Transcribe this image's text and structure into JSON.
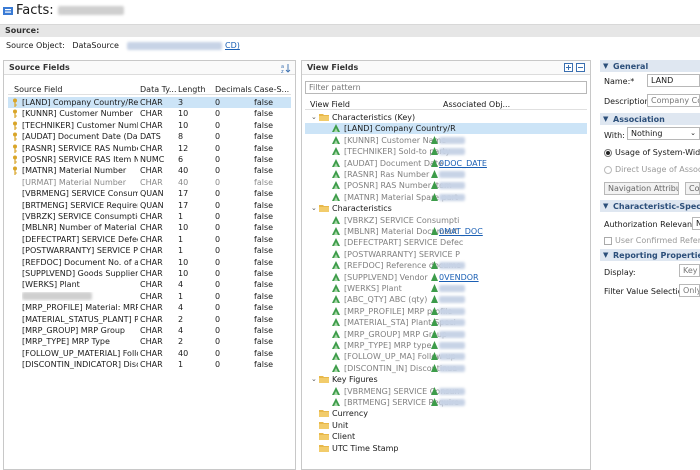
{
  "window": {
    "title": "Facts:"
  },
  "source_section": {
    "label": "Source:",
    "object_label": "Source Object:",
    "object_type": "DataSource",
    "object_link": "CD)"
  },
  "source_fields": {
    "title": "Source Fields",
    "columns": [
      "Source Field",
      "Data Ty...",
      "Length",
      "Decimals",
      "Case-S..."
    ],
    "rows": [
      {
        "field": "[LAND] Company Country/Regio",
        "type": "CHAR",
        "length": "3",
        "decimals": "0",
        "case": "false",
        "key": true,
        "selected": true
      },
      {
        "field": "[KUNNR] Customer Number",
        "type": "CHAR",
        "length": "10",
        "decimals": "0",
        "case": "false",
        "key": true
      },
      {
        "field": "[TECHNIKER] Customer Number",
        "type": "CHAR",
        "length": "10",
        "decimals": "0",
        "case": "false",
        "key": true
      },
      {
        "field": "[AUDAT] Document Date (Date R",
        "type": "DATS",
        "length": "8",
        "decimals": "0",
        "case": "false",
        "key": true
      },
      {
        "field": "[RASNR] SERVICE RAS Number",
        "type": "CHAR",
        "length": "12",
        "decimals": "0",
        "case": "false",
        "key": true
      },
      {
        "field": "[POSNR] SERVICE RAS Item Num",
        "type": "NUMC",
        "length": "6",
        "decimals": "0",
        "case": "false",
        "key": true
      },
      {
        "field": "[MATNR] Material Number",
        "type": "CHAR",
        "length": "40",
        "decimals": "0",
        "case": "false",
        "key": true
      },
      {
        "field": "[URMAT] Material Number",
        "type": "CHAR",
        "length": "40",
        "decimals": "0",
        "case": "false",
        "grey": true
      },
      {
        "field": "[VBRMENG] SERVICE Consumptic",
        "type": "QUAN",
        "length": "17",
        "decimals": "0",
        "case": "false"
      },
      {
        "field": "[BRTMENG] SERVICE Requiremen",
        "type": "QUAN",
        "length": "17",
        "decimals": "0",
        "case": "false"
      },
      {
        "field": "[VBRZK] SERVICE Consumption S",
        "type": "CHAR",
        "length": "1",
        "decimals": "0",
        "case": "false"
      },
      {
        "field": "[MBLNR] Number of Material Do",
        "type": "CHAR",
        "length": "10",
        "decimals": "0",
        "case": "false"
      },
      {
        "field": "[DEFECTPART] SERVICE Defect Pa",
        "type": "CHAR",
        "length": "1",
        "decimals": "0",
        "case": "false"
      },
      {
        "field": "[POSTWARRANTY] SERVICE Post",
        "type": "CHAR",
        "length": "1",
        "decimals": "0",
        "case": "false"
      },
      {
        "field": "[REFDOC] Document No. of a Ref",
        "type": "CHAR",
        "length": "10",
        "decimals": "0",
        "case": "false"
      },
      {
        "field": "[SUPPLVEND] Goods Supplier",
        "type": "CHAR",
        "length": "10",
        "decimals": "0",
        "case": "false"
      },
      {
        "field": "[WERKS] Plant",
        "type": "CHAR",
        "length": "4",
        "decimals": "0",
        "case": "false"
      },
      {
        "field": "",
        "type": "CHAR",
        "length": "1",
        "decimals": "0",
        "case": "false",
        "blurred": true
      },
      {
        "field": "[MRP_PROFILE] Material: MRP pr",
        "type": "CHAR",
        "length": "4",
        "decimals": "0",
        "case": "false"
      },
      {
        "field": "[MATERIAL_STATUS_PLANT] Plar",
        "type": "CHAR",
        "length": "2",
        "decimals": "0",
        "case": "false"
      },
      {
        "field": "[MRP_GROUP] MRP Group",
        "type": "CHAR",
        "length": "4",
        "decimals": "0",
        "case": "false"
      },
      {
        "field": "[MRP_TYPE] MRP Type",
        "type": "CHAR",
        "length": "2",
        "decimals": "0",
        "case": "false"
      },
      {
        "field": "[FOLLOW_UP_MATERIAL] Follow",
        "type": "CHAR",
        "length": "40",
        "decimals": "0",
        "case": "false"
      },
      {
        "field": "[DISCONTIN_INDICATOR] Discon",
        "type": "CHAR",
        "length": "1",
        "decimals": "0",
        "case": "false"
      }
    ]
  },
  "view_fields": {
    "title": "View Fields",
    "filter_placeholder": "Filter pattern",
    "columns": [
      "View Field",
      "Associated Obj..."
    ],
    "rows": [
      {
        "level": 0,
        "kind": "folder",
        "text": "Characteristics (Key)",
        "expanded": true
      },
      {
        "level": 1,
        "kind": "field",
        "text": "[LAND] Company Country/R",
        "selected": true
      },
      {
        "level": 1,
        "kind": "field",
        "text": "[KUNNR] Customer Name",
        "grey": true,
        "assoc_blur": true
      },
      {
        "level": 1,
        "kind": "field",
        "text": "[TECHNIKER] Sold-to party",
        "grey": true,
        "assoc_blur": true
      },
      {
        "level": 1,
        "kind": "field",
        "text": "[AUDAT] Document Date",
        "grey": true,
        "assoc": "0DOC_DATE"
      },
      {
        "level": 1,
        "kind": "field",
        "text": "[RASNR] Ras Number",
        "grey": true,
        "assoc_blur": true
      },
      {
        "level": 1,
        "kind": "field",
        "text": "[POSNR] RAS Number Item",
        "grey": true,
        "assoc_blur": true
      },
      {
        "level": 1,
        "kind": "field",
        "text": "[MATNR] Material Spare part",
        "grey": true,
        "assoc_blur": true
      },
      {
        "level": 0,
        "kind": "folder",
        "text": "Characteristics",
        "expanded": true
      },
      {
        "level": 1,
        "kind": "field",
        "text": "[VBRKZ] SERVICE Consumpti",
        "grey": true
      },
      {
        "level": 1,
        "kind": "field",
        "text": "[MBLNR] Material Document",
        "grey": true,
        "assoc": "0MAT_DOC"
      },
      {
        "level": 1,
        "kind": "field",
        "text": "[DEFECTPART] SERVICE Defec",
        "grey": true
      },
      {
        "level": 1,
        "kind": "field",
        "text": "[POSTWARRANTY] SERVICE P",
        "grey": true
      },
      {
        "level": 1,
        "kind": "field",
        "text": "[REFDOC] Reference docume",
        "grey": true,
        "assoc_blur": true
      },
      {
        "level": 1,
        "kind": "field",
        "text": "[SUPPLVEND] Vendor",
        "grey": true,
        "assoc": "0VENDOR"
      },
      {
        "level": 1,
        "kind": "field",
        "text": "[WERKS] Plant",
        "grey": true,
        "assoc_blur": true
      },
      {
        "level": 1,
        "kind": "field",
        "text": "[ABC_QTY] ABC (qty)",
        "grey": true,
        "assoc_blur": true
      },
      {
        "level": 1,
        "kind": "field",
        "text": "[MRP_PROFILE] MRP profile",
        "grey": true,
        "assoc_blur": true
      },
      {
        "level": 1,
        "kind": "field",
        "text": "[MATERIAL_STA] Plant-Speci",
        "grey": true,
        "assoc_blur": true
      },
      {
        "level": 1,
        "kind": "field",
        "text": "[MRP_GROUP] MRP Group",
        "grey": true,
        "assoc_blur": true
      },
      {
        "level": 1,
        "kind": "field",
        "text": "[MRP_TYPE] MRP type",
        "grey": true,
        "assoc_blur": true
      },
      {
        "level": 1,
        "kind": "field",
        "text": "[FOLLOW_UP_MA] Follow-up",
        "grey": true,
        "assoc_blur": true
      },
      {
        "level": 1,
        "kind": "field",
        "text": "[DISCONTIN_IN] Discontinua",
        "grey": true,
        "assoc_blur": true
      },
      {
        "level": 0,
        "kind": "folder",
        "text": "Key Figures",
        "expanded": true
      },
      {
        "level": 1,
        "kind": "field",
        "text": "[VBRMENG] SERVICE Consun",
        "grey": true,
        "assoc_blur": true
      },
      {
        "level": 1,
        "kind": "field",
        "text": "[BRTMENG] SERVICE Require",
        "grey": true,
        "assoc_blur": true
      },
      {
        "level": 0,
        "kind": "folder",
        "text": "Currency"
      },
      {
        "level": 0,
        "kind": "folder",
        "text": "Unit"
      },
      {
        "level": 0,
        "kind": "folder",
        "text": "Client"
      },
      {
        "level": 0,
        "kind": "folder",
        "text": "UTC Time Stamp"
      }
    ]
  },
  "properties": {
    "general": "General",
    "name_label": "Name:*",
    "name_value": "LAND",
    "description_label": "Description:",
    "description_value": "Company Co",
    "association": "Association",
    "with_label": "With:",
    "with_value": "Nothing",
    "usage_system": "Usage of System-Wide Ur",
    "direct_usage": "Direct Usage of Associate",
    "nav_attr_btn": "Navigation Attributes",
    "co_btn": "Co",
    "char_specific": "Characteristic-Specific P",
    "auth_label": "Authorization Relevance:",
    "auth_value": "N",
    "user_confirmed": "User Confirmed Referenti",
    "reporting": "Reporting Properties",
    "display_label": "Display:",
    "display_value": "Key",
    "filter_label": "Filter Value Selection:",
    "filter_value": "Only"
  },
  "colors": {
    "accent": "#2c4f7a",
    "selection": "#cce4f7",
    "link": "#1a5fb4"
  }
}
